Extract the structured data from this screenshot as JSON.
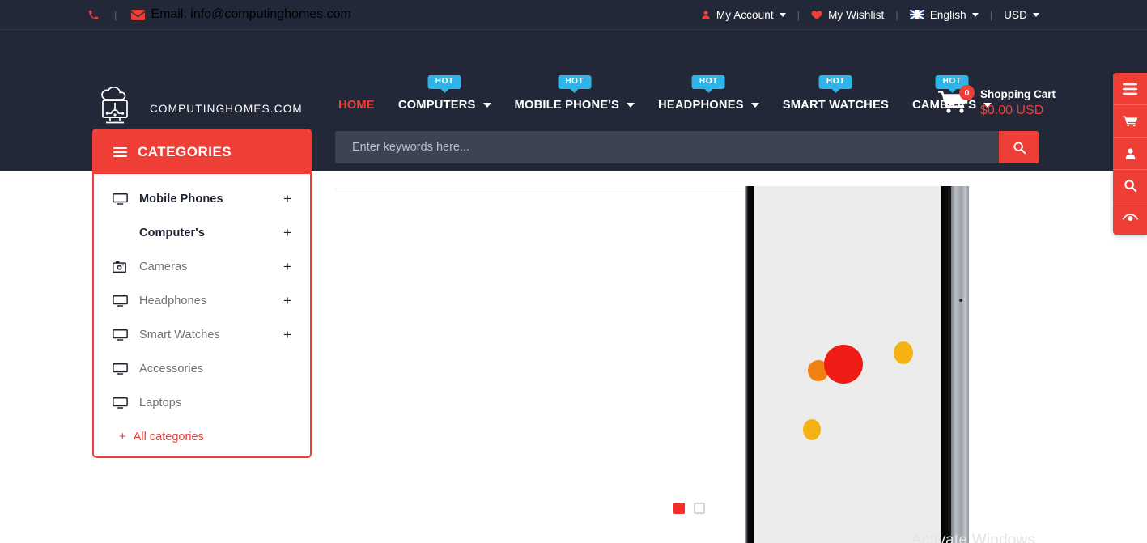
{
  "topbar": {
    "phone_icon": "phone-icon",
    "email_icon": "envelope-icon",
    "email_text": "Email: info@computinghomes.com",
    "separator": "|",
    "account_label": "My Account",
    "wishlist_label": "My Wishlist",
    "language_label": "English",
    "currency_label": "USD"
  },
  "header": {
    "logo_text": "COMPUTINGHOMES.COM",
    "nav": [
      {
        "label": "HOME",
        "active": true,
        "caret": false,
        "hot": ""
      },
      {
        "label": "COMPUTERS",
        "active": false,
        "caret": true,
        "hot": "HOT"
      },
      {
        "label": "MOBILE PHONE'S",
        "active": false,
        "caret": true,
        "hot": "HOT"
      },
      {
        "label": "HEADPHONES",
        "active": false,
        "caret": true,
        "hot": "HOT"
      },
      {
        "label": "SMART WATCHES",
        "active": false,
        "caret": false,
        "hot": "HOT"
      },
      {
        "label": "CAMERA'S",
        "active": false,
        "caret": true,
        "hot": "HOT"
      }
    ],
    "cart": {
      "count": "0",
      "title": "Shopping Cart",
      "price": "$0.00 USD"
    }
  },
  "categories": {
    "title": "CATEGORIES",
    "items": [
      {
        "label": "Mobile Phones",
        "plus": "+",
        "icon": "monitor-icon",
        "strong": true
      },
      {
        "label": "Computer's",
        "plus": "+",
        "icon": "",
        "strong": true
      },
      {
        "label": "Cameras",
        "plus": "+",
        "icon": "camera-icon",
        "strong": false
      },
      {
        "label": "Headphones",
        "plus": "+",
        "icon": "monitor-icon",
        "strong": false
      },
      {
        "label": "Smart Watches",
        "plus": "+",
        "icon": "monitor-icon",
        "strong": false
      },
      {
        "label": "Accessories",
        "plus": "",
        "icon": "monitor-icon",
        "strong": false
      },
      {
        "label": "Laptops",
        "plus": "",
        "icon": "monitor-icon",
        "strong": false
      }
    ],
    "all_categories": "All categories",
    "all_categories_plus": "+"
  },
  "search": {
    "placeholder": "Enter keywords here...",
    "value": "",
    "button_icon": "search-icon"
  },
  "slider": {
    "dots": [
      {
        "state": "active"
      },
      {
        "state": "idle"
      }
    ]
  },
  "dock": [
    {
      "icon": "menu-list-icon"
    },
    {
      "icon": "cart-icon"
    },
    {
      "icon": "user-icon"
    },
    {
      "icon": "search-icon"
    },
    {
      "icon": "eye-icon"
    }
  ],
  "watermark": "Activate Windows",
  "colors": {
    "brand_red": "#ef3e36",
    "header_dark": "#222838",
    "badge_blue": "#2eb4e8",
    "search_field": "#3c4353"
  }
}
